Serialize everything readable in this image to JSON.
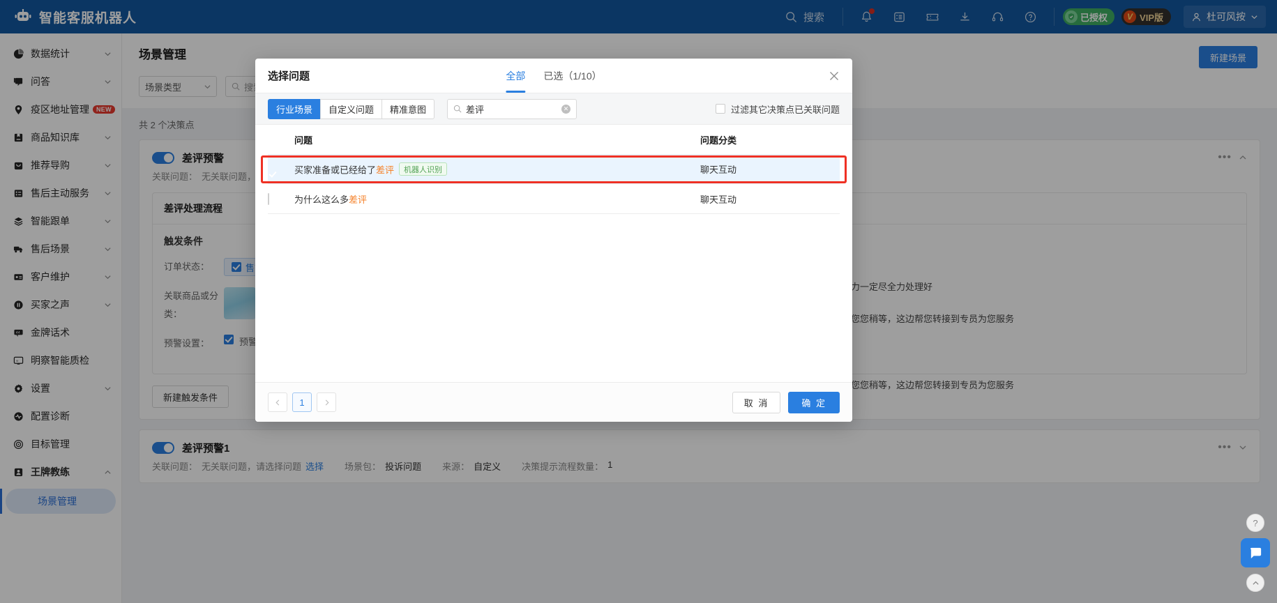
{
  "topbar": {
    "brand": "智能客服机器人",
    "brand_icon": "robot-icon",
    "search_label": "搜索",
    "search_icon": "search-icon",
    "icons": [
      "bell-icon",
      "form-icon",
      "ticket-icon",
      "download-icon",
      "headset-icon",
      "question-circle-icon"
    ],
    "auth_badge": "已授权",
    "vip_badge": "VIP版",
    "vip_mark": "V",
    "user_name": "杜可风按",
    "user_icon": "user-icon",
    "chevron_icon": "chevron-down-icon",
    "bg_color": "#1258a0"
  },
  "sidebar": {
    "items": [
      {
        "label": "数据统计",
        "icon": "pie-chart-icon",
        "expandable": true
      },
      {
        "label": "问答",
        "icon": "chat-icon",
        "expandable": true
      },
      {
        "label": "疫区地址管理",
        "icon": "location-pin-icon",
        "expandable": false,
        "badge": "NEW"
      },
      {
        "label": "商品知识库",
        "icon": "book-icon",
        "expandable": true
      },
      {
        "label": "推荐导购",
        "icon": "bag-icon",
        "expandable": true
      },
      {
        "label": "售后主动服务",
        "icon": "list-card-icon",
        "expandable": true
      },
      {
        "label": "智能跟单",
        "icon": "layers-icon",
        "expandable": true
      },
      {
        "label": "售后场景",
        "icon": "truck-icon",
        "expandable": true
      },
      {
        "label": "客户维护",
        "icon": "id-card-icon",
        "expandable": true
      },
      {
        "label": "买家之声",
        "icon": "megaphone-icon",
        "expandable": true
      },
      {
        "label": "金牌话术",
        "icon": "quote-icon",
        "expandable": false
      },
      {
        "label": "明察智能质检",
        "icon": "monitor-icon",
        "expandable": false
      },
      {
        "label": "设置",
        "icon": "gear-icon",
        "expandable": true
      },
      {
        "label": "配置诊断",
        "icon": "pulse-icon",
        "expandable": false
      },
      {
        "label": "目标管理",
        "icon": "target-icon",
        "expandable": false
      },
      {
        "label": "王牌教练",
        "icon": "coach-icon",
        "expandable": true,
        "expanded": true
      }
    ],
    "active_sub": "场景管理",
    "active_color": "#2a6fd6"
  },
  "main": {
    "page_title": "场景管理",
    "filter_select": "场景类型",
    "filter_input_placeholder": "搜索",
    "new_scene_button": "新建场景",
    "count_text": "共 2 个决策点",
    "cards": [
      {
        "title": "差评预警",
        "enabled": true,
        "relation_label": "关联问题：",
        "relation_value": "无关联问题，请选择问题",
        "section_title": "差评处理流程",
        "trigger_title": "触发条件",
        "rows": [
          {
            "label": "订单状态：",
            "chip": "售前"
          },
          {
            "label": "关联商品或分类：",
            "thumbs": [
              "商品图",
              "SKU"
            ]
          },
          {
            "label": "预警设置：",
            "chip": "预警弹窗"
          }
        ],
        "new_trigger_button": "新建触发条件"
      },
      {
        "title": "差评预警1",
        "enabled": true,
        "relation_label": "关联问题：",
        "relation_value": "无关联问题，请选择问题",
        "relation_link": "选择",
        "pack_label": "场景包：",
        "pack_value": "投诉问题",
        "source_label": "来源：",
        "source_value": "自定义",
        "flow_label": "决策提示流程数量：",
        "flow_value": "1"
      }
    ],
    "chat_lines": [
      "力一定尽全力处理好",
      "您您稍等，这边帮您转接到专员为您服务",
      "您您稍等，这边帮您转接到专员为您服务"
    ]
  },
  "modal": {
    "title": "选择问题",
    "close_icon": "close-icon",
    "tabs": [
      {
        "label": "全部",
        "active": true
      },
      {
        "label": "已选（1/10）",
        "active": false
      }
    ],
    "segments": [
      {
        "label": "行业场景",
        "active": true
      },
      {
        "label": "自定义问题",
        "active": false
      },
      {
        "label": "精准意图",
        "active": false
      }
    ],
    "search": {
      "icon": "search-icon",
      "value": "差评",
      "clear_icon": "clear-circle-icon"
    },
    "filter_checkbox": {
      "label": "过滤其它决策点已关联问题",
      "checked": false
    },
    "table": {
      "headers": [
        "问题",
        "问题分类"
      ],
      "header_checkbox_state": "indeterminate",
      "rows": [
        {
          "checked": true,
          "question_prefix": "买家准备或已经给了",
          "question_keyword": "差评",
          "question_suffix": "",
          "tag": "机器人识别",
          "category": "聊天互动",
          "highlighted": true
        },
        {
          "checked": false,
          "question_prefix": "为什么这么多",
          "question_keyword": "差评",
          "question_suffix": "",
          "tag": "",
          "category": "聊天互动",
          "highlighted": false
        }
      ]
    },
    "pagination": {
      "prev_icon": "chevron-left-icon",
      "current": "1",
      "next_icon": "chevron-right-icon"
    },
    "cancel_button": "取 消",
    "confirm_button": "确 定",
    "accent_color": "#2a7fe0",
    "highlight_box_color": "#ef3124",
    "keyword_color": "#f5822a"
  },
  "float_widgets": {
    "chat_icon": "chat-bubble-icon",
    "help_icon": "question-icon",
    "top_icon": "caret-up-icon"
  }
}
